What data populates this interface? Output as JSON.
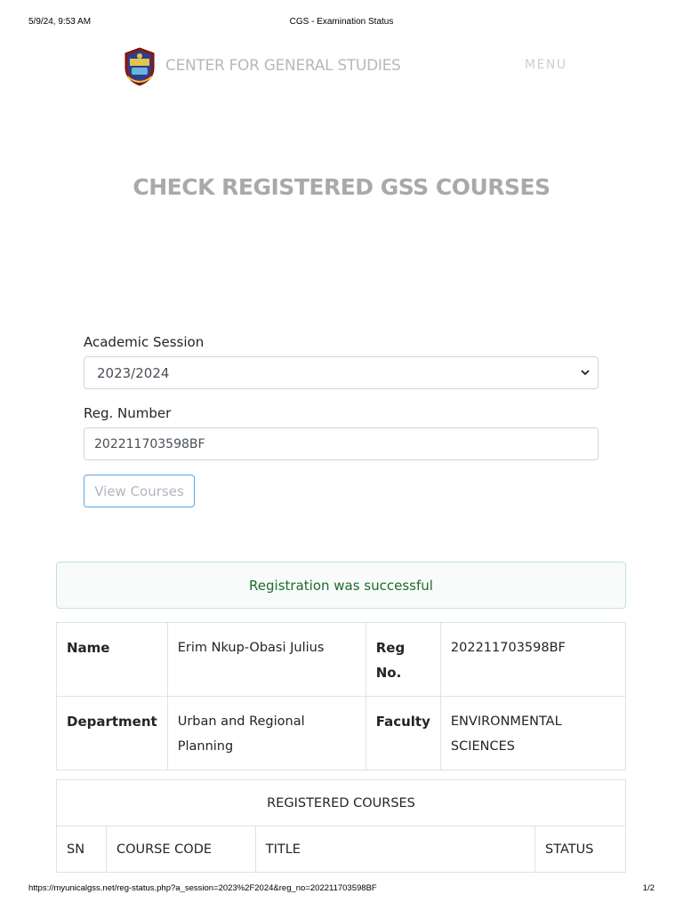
{
  "print": {
    "datetime": "5/9/24, 9:53 AM",
    "doc_title": "CGS - Examination Status",
    "url": "https://myunicalgss.net/reg-status.php?a_session=2023%2F2024&reg_no=202211703598BF",
    "page": "1/2"
  },
  "nav": {
    "brand": "CENTER FOR GENERAL STUDIES",
    "menu": "MENU",
    "logo_icon": "university-crest-icon"
  },
  "page_title": "CHECK REGISTERED GSS COURSES",
  "form": {
    "session_label": "Academic Session",
    "session_value": "2023/2024",
    "reg_label": "Reg. Number",
    "reg_value": "202211703598BF",
    "submit_label": "View Courses"
  },
  "alert": "Registration was successful",
  "student": {
    "name_label": "Name",
    "name_value": "Erim Nkup-Obasi Julius",
    "reg_label": "Reg No.",
    "reg_value": "202211703598BF",
    "dept_label": "Department",
    "dept_value": "Urban and Regional Planning",
    "faculty_label": "Faculty",
    "faculty_value": "ENVIRONMENTAL SCIENCES"
  },
  "courses": {
    "caption": "REGISTERED COURSES",
    "columns": [
      "SN",
      "COURSE CODE",
      "TITLE",
      "STATUS"
    ]
  },
  "colors": {
    "alert_text": "#1e6b2f",
    "alert_border": "#c3e6cb",
    "button_border": "#5aa6e6",
    "title_gray": "#a9a9a9"
  }
}
